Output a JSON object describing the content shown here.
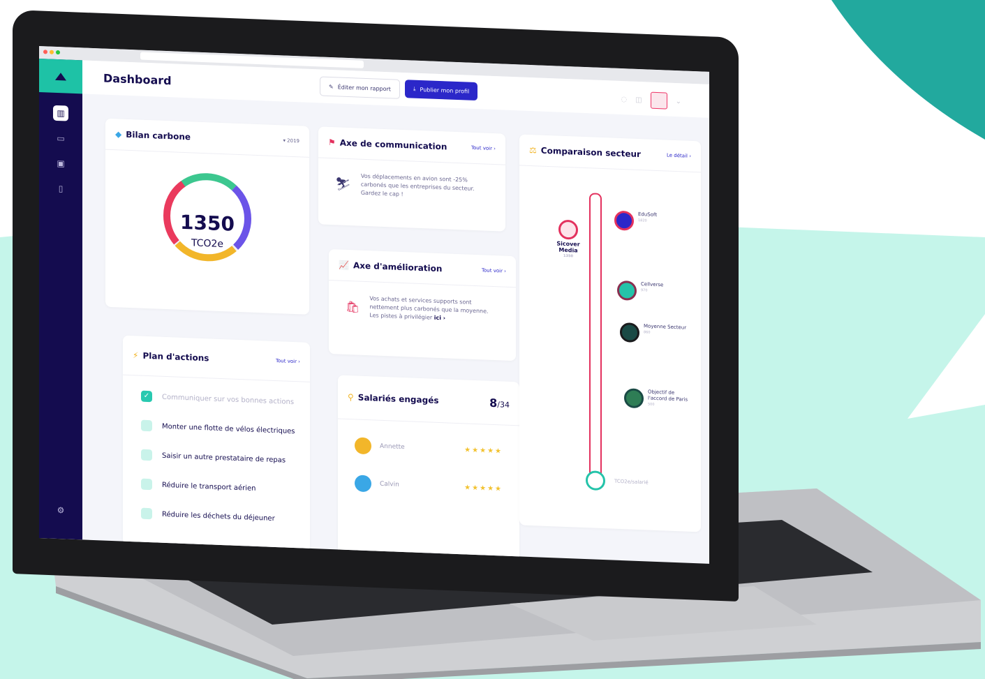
{
  "colors": {
    "teal": "#22a99e",
    "mint": "#c5f5ea",
    "navy": "#140c4f",
    "accent": "#2b27c9",
    "green": "#28c9b0"
  },
  "header": {
    "title": "Dashboard",
    "edit_label": "Éditer mon rapport",
    "publish_label": "Publier mon profil"
  },
  "sidebar": {
    "icons": [
      "home-icon",
      "folder-icon",
      "inbox-icon",
      "document-icon",
      "settings-icon"
    ]
  },
  "bilan": {
    "title": "Bilan carbone",
    "year": "▾ 2019",
    "value": "1350",
    "unit": "TCO2e"
  },
  "communication": {
    "title": "Axe de communication",
    "see_all": "Tout voir ›",
    "text": "Vos déplacements en avion sont -25% carbonés que les entreprises du secteur. Gardez le cap !"
  },
  "amelioration": {
    "title": "Axe d'amélioration",
    "see_all": "Tout voir ›",
    "text": "Vos achats et services supports sont nettement plus carbonés que la moyenne. Les pistes à privilégier",
    "link": "ici ›"
  },
  "comparaison": {
    "title": "Comparaison secteur",
    "detail": "Le détail ›",
    "unit": "TCO2e/salarié",
    "pins": [
      {
        "label": "EduSoft",
        "value": "1820"
      },
      {
        "label": "Sicover Media",
        "value": "1350"
      },
      {
        "label": "Cellverse",
        "value": "970"
      },
      {
        "label": "Moyenne Secteur",
        "value": "860"
      },
      {
        "label": "Objectif de l'accord de Paris",
        "value": "500"
      }
    ]
  },
  "plan": {
    "title": "Plan d'actions",
    "see_all": "Tout voir ›",
    "items": [
      {
        "label": "Communiquer sur vos bonnes actions",
        "done": true
      },
      {
        "label": "Monter une flotte de vélos électriques",
        "done": false
      },
      {
        "label": "Saisir un autre prestataire de repas",
        "done": false
      },
      {
        "label": "Réduire le transport aérien",
        "done": false
      },
      {
        "label": "Réduire les déchets du déjeuner",
        "done": false
      }
    ]
  },
  "salaries": {
    "title": "Salariés engagés",
    "count": "8",
    "total": "/34",
    "people": [
      {
        "name": "Annette",
        "stars": "★★★★★"
      },
      {
        "name": "Calvin",
        "stars": "★★★★★"
      }
    ]
  }
}
